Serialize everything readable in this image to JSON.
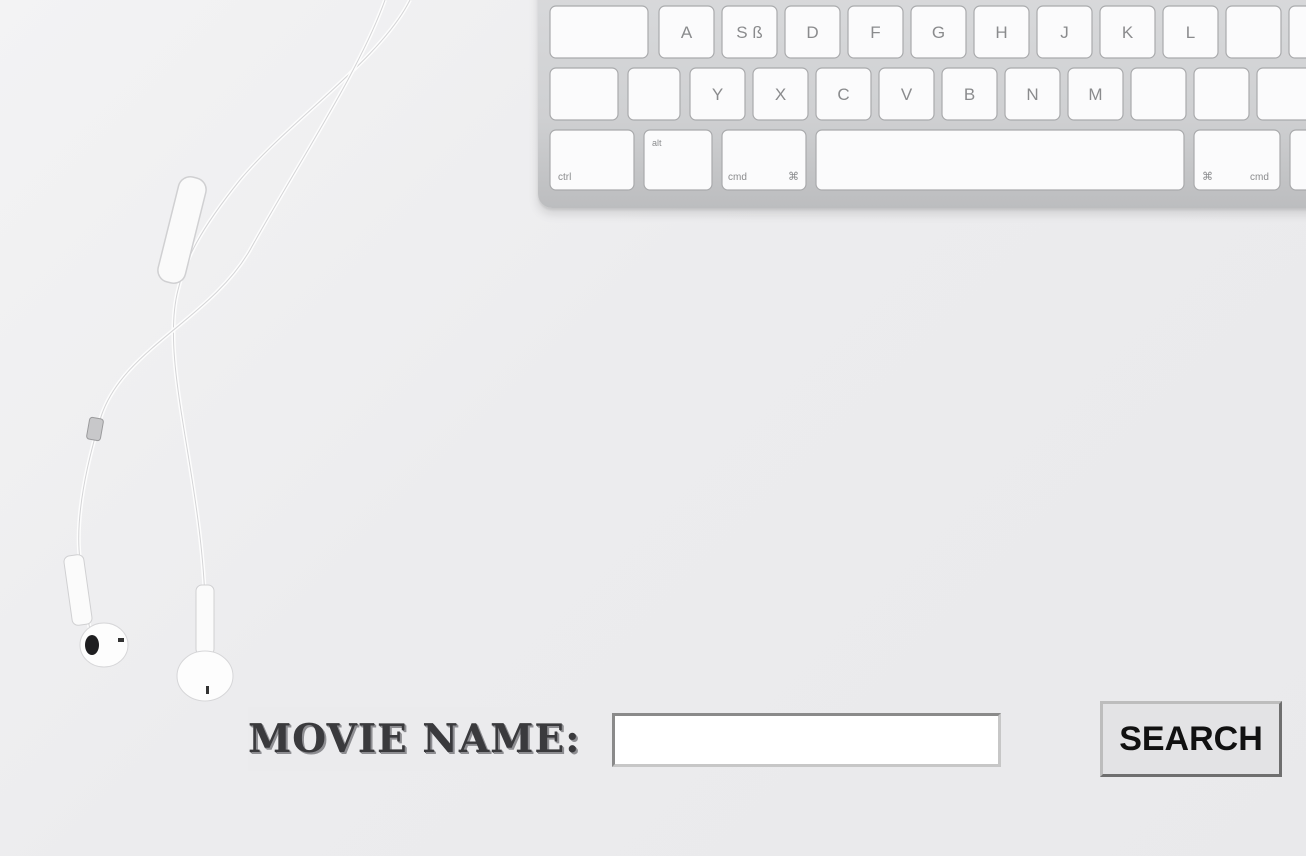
{
  "form": {
    "label": "MOVIE NAME:",
    "input_value": "",
    "input_placeholder": "",
    "button_label": "SEARCH"
  },
  "background": {
    "keyboard_keys": {
      "row1": [
        "A",
        "S ß",
        "D",
        "F",
        "G",
        "H",
        "J",
        "K",
        "L"
      ],
      "row2": [
        "Y",
        "X",
        "C",
        "V",
        "B",
        "N",
        "M"
      ],
      "bottom_labels": [
        "ctrl",
        "alt",
        "cmd",
        "⌘",
        "⌘",
        "cmd"
      ]
    }
  }
}
